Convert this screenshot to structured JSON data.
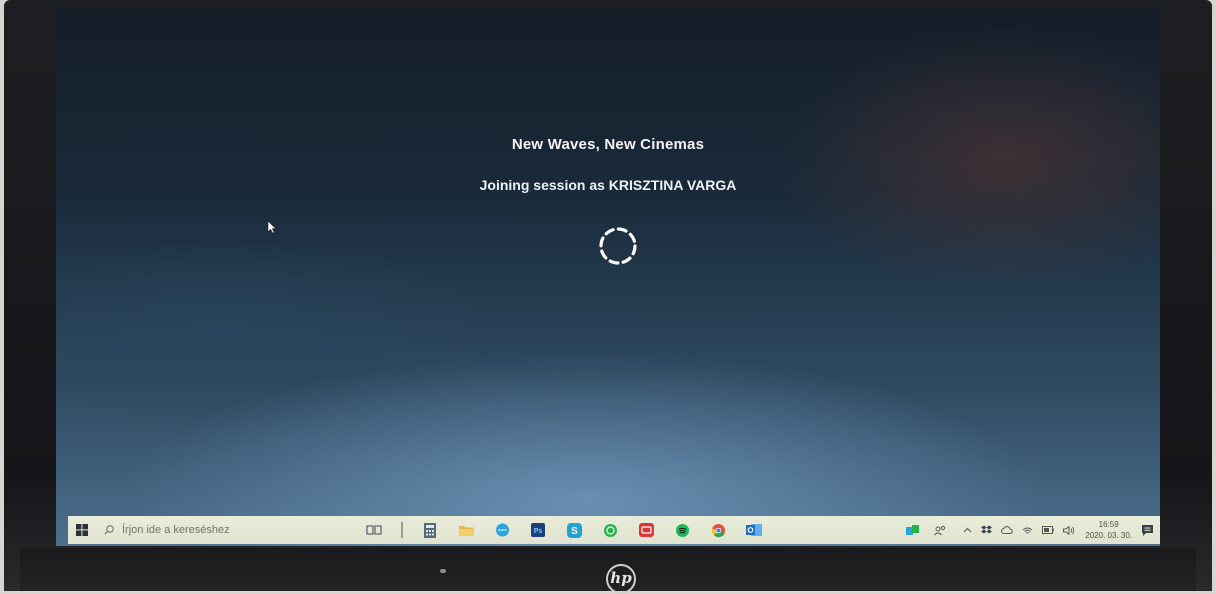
{
  "screen": {
    "title": "New Waves, New Cinemas",
    "status": "Joining session as KRISZTINA VARGA"
  },
  "taskbar": {
    "search_placeholder": "Írjon ide a kereséshez",
    "apps": [
      {
        "name": "task-view-icon",
        "color": "#6b7280"
      },
      {
        "name": "divider-icon",
        "color": "#9aa090"
      },
      {
        "name": "calculator-icon",
        "color": "#5a6a7a"
      },
      {
        "name": "file-explorer-icon",
        "color": "#e0b84a"
      },
      {
        "name": "messenger-icon",
        "color": "#2aa3e0"
      },
      {
        "name": "photoshop-icon",
        "color": "#1f5ea8"
      },
      {
        "name": "skype-icon",
        "color": "#1ea3d6"
      },
      {
        "name": "whatsapp-icon",
        "color": "#27b34a"
      },
      {
        "name": "screen-capture-icon",
        "color": "#d9373a"
      },
      {
        "name": "spotify-icon",
        "color": "#1db954"
      },
      {
        "name": "chrome-icon",
        "color": "#e0533b"
      },
      {
        "name": "outlook-icon",
        "color": "#1f7fd0"
      }
    ],
    "clock": {
      "time": "16:59",
      "date": "2020. 03. 30."
    }
  },
  "device": {
    "brand": "hp"
  },
  "colors": {
    "taskbar_bg": "#e3e7d4",
    "screen_top": "#141d28",
    "screen_bottom": "#4d6f8c"
  }
}
